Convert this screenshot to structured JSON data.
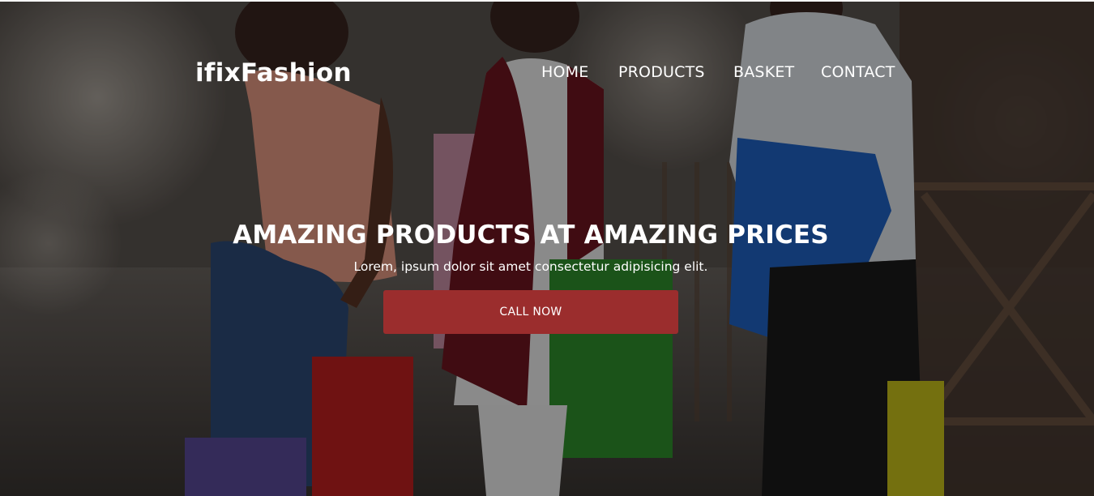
{
  "brand": {
    "name": "ifixFashion"
  },
  "nav": {
    "items": [
      {
        "label": "HOME"
      },
      {
        "label": "PRODUCTS"
      },
      {
        "label": "BASKET"
      },
      {
        "label": "CONTACT"
      }
    ]
  },
  "hero": {
    "headline": "AMAZING PRODUCTS AT AMAZING PRICES",
    "subtext": "Lorem, ipsum dolor sit amet consectetur adipisicing elit.",
    "cta_label": "CALL NOW",
    "background_image": "shopping-women-with-bags-photo"
  },
  "colors": {
    "cta": "#9b2d2d",
    "text": "#ffffff",
    "overlay": "rgba(0,0,0,0.42)"
  }
}
